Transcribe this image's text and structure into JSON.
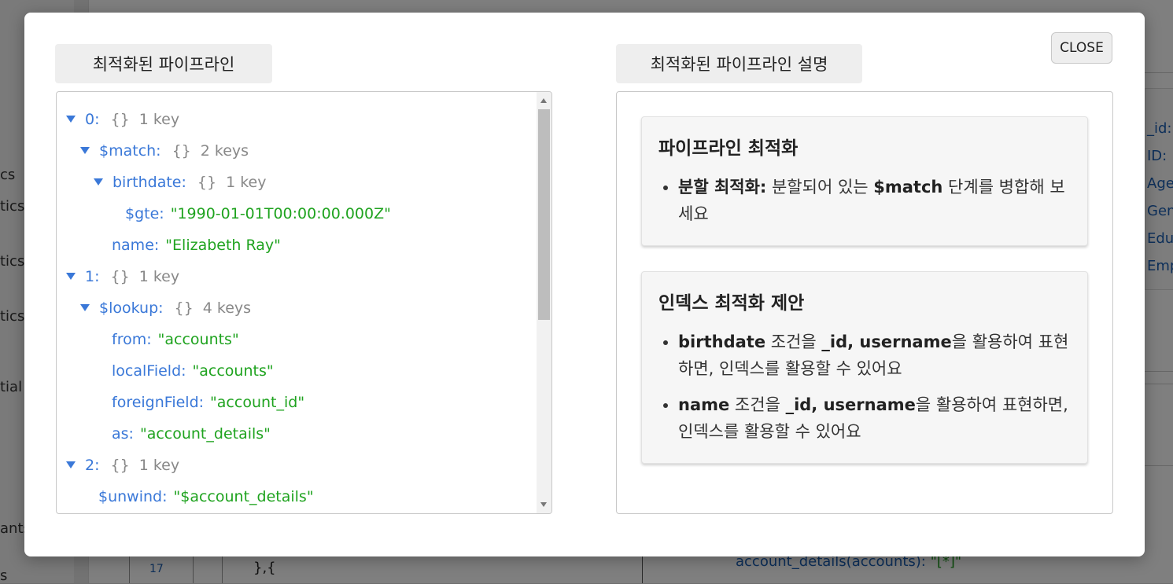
{
  "background": {
    "sidebar_fragments": [
      "cs",
      "tics",
      "tics",
      "tics",
      "tial",
      "ants",
      "s"
    ],
    "right_fields": [
      "_id:",
      "ID:",
      "Age",
      "Gen",
      "Edu",
      "Emp"
    ],
    "editor_line_number": "17",
    "editor_code": "},{",
    "bottom_key": "account_details(accounts):",
    "bottom_value": "\"[*]\""
  },
  "modal": {
    "close_label": "CLOSE",
    "left_tab": "최적화된 파이프라인",
    "right_tab": "최적화된 파이프라인 설명"
  },
  "json_tree": [
    {
      "key": "0:",
      "brace": "{}",
      "count": "1 key"
    },
    {
      "key": "$match:",
      "brace": "{}",
      "count": "2 keys"
    },
    {
      "key": "birthdate:",
      "brace": "{}",
      "count": "1 key"
    },
    {
      "key": "$gte:",
      "value": "\"1990-01-01T00:00:00.000Z\""
    },
    {
      "key": "name:",
      "value": "\"Elizabeth Ray\""
    },
    {
      "key": "1:",
      "brace": "{}",
      "count": "1 key"
    },
    {
      "key": "$lookup:",
      "brace": "{}",
      "count": "4 keys"
    },
    {
      "key": "from:",
      "value": "\"accounts\""
    },
    {
      "key": "localField:",
      "value": "\"accounts\""
    },
    {
      "key": "foreignField:",
      "value": "\"account_id\""
    },
    {
      "key": "as:",
      "value": "\"account_details\""
    },
    {
      "key": "2:",
      "brace": "{}",
      "count": "1 key"
    },
    {
      "key": "$unwind:",
      "value": "\"$account_details\""
    }
  ],
  "cards": [
    {
      "title": "파이프라인 최적화",
      "items": [
        {
          "bold": "분할 최적화:",
          "text1": " 분할되어 있는 ",
          "bold2": "$match",
          "text2": " 단계를 병합해 보세요"
        }
      ]
    },
    {
      "title": "인덱스 최적화 제안",
      "items": [
        {
          "bold": "birthdate",
          "text1": " 조건을 ",
          "bold2": "_id, username",
          "text2": "을 활용하여 표현하면, 인덱스를 활용할 수 있어요"
        },
        {
          "bold": "name",
          "text1": " 조건을 ",
          "bold2": "_id, username",
          "text2": "을 활용하여 표현하면, 인덱스를 활용할 수 있어요"
        }
      ]
    }
  ]
}
